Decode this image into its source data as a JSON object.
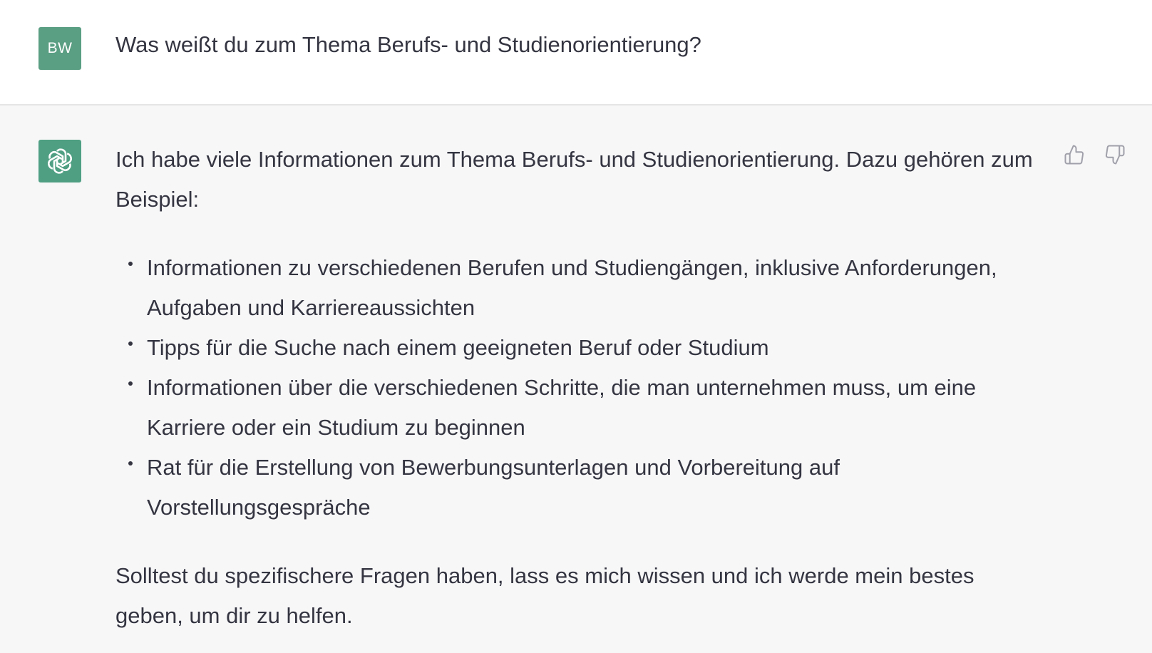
{
  "user_message": {
    "avatar_initials": "BW",
    "text": "Was weißt du zum Thema Berufs- und Studienorientierung?"
  },
  "assistant_message": {
    "avatar_icon": "openai-logo-icon",
    "intro": "Ich habe viele Informationen zum Thema Berufs- und Studienorientierung. Dazu gehören zum Beispiel:",
    "bullets": [
      "Informationen zu verschiedenen Berufen und Studiengängen, inklusive Anforderungen, Aufgaben und Karriereaussichten",
      "Tipps für die Suche nach einem geeigneten Beruf oder Studium",
      "Informationen über die verschiedenen Schritte, die man unternehmen muss, um eine Karriere oder ein Studium zu beginnen",
      "Rat für die Erstellung von Bewerbungsunterlagen und Vorbereitung auf Vorstellungsgespräche"
    ],
    "outro": "Solltest du spezifischere Fragen haben, lass es mich wissen und ich werde mein bestes geben, um dir zu helfen."
  },
  "feedback": {
    "up_icon": "thumbs-up-icon",
    "down_icon": "thumbs-down-icon"
  },
  "colors": {
    "user_avatar_bg": "#5a9e83",
    "bot_avatar_bg": "#4f9f83",
    "text": "#343541",
    "assistant_bg": "#f7f7f8",
    "user_bg": "#ffffff"
  }
}
